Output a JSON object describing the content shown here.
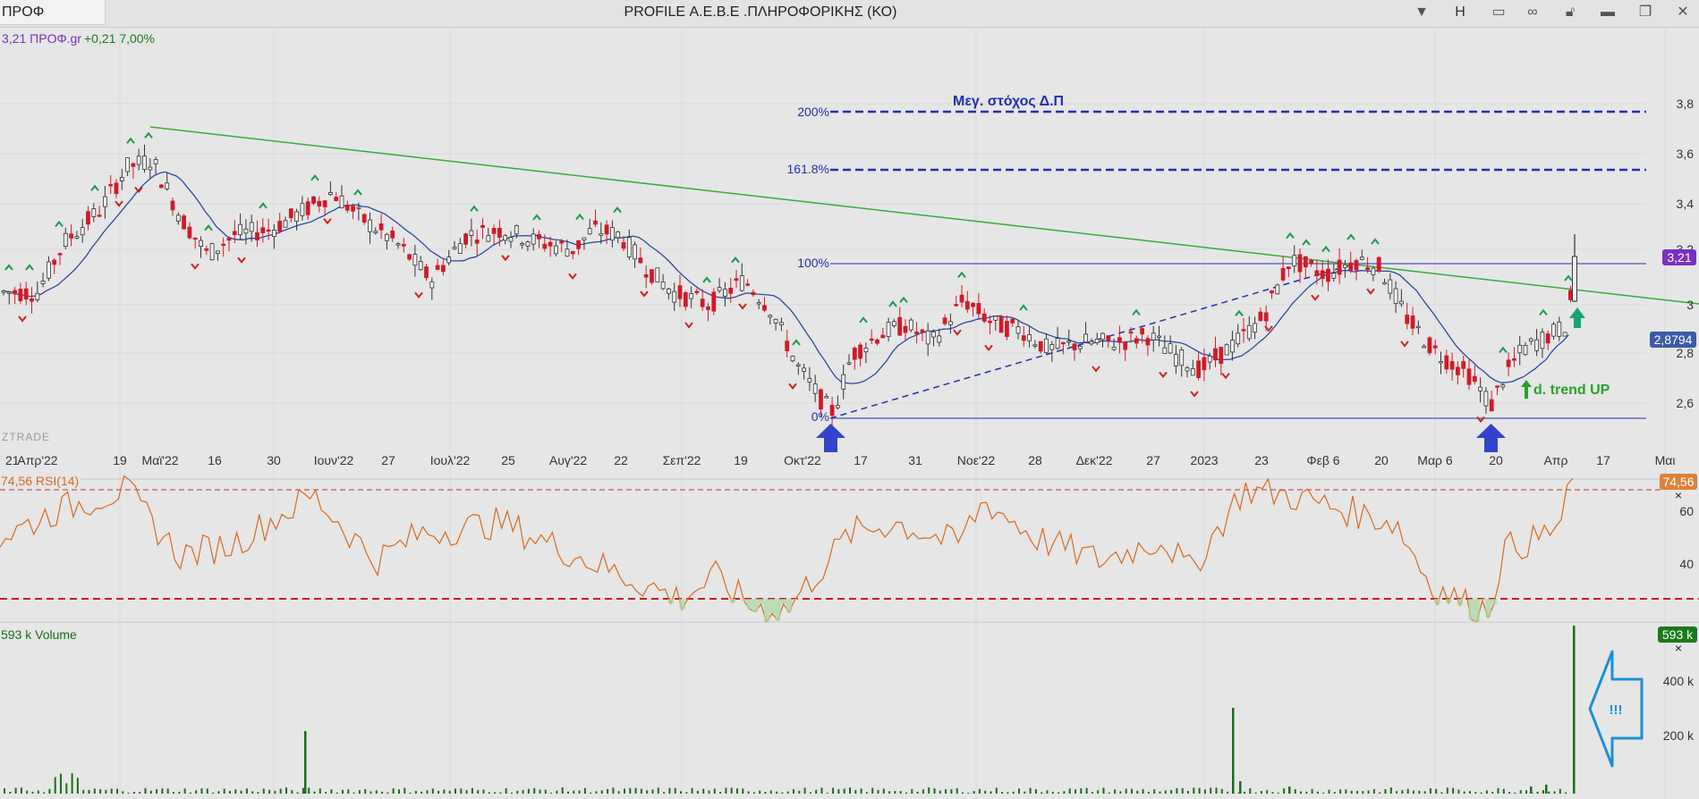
{
  "window": {
    "symbol_tab": "ΠΡΟΦ",
    "title": "PROFILE Α.Ε.Β.Ε .ΠΛΗΡΟΦΟΡΙΚΗΣ (ΚΟ)",
    "h_label": "H"
  },
  "quote": {
    "price_symbol": "3,21 ΠΡΟΦ.gr",
    "change": "+0,21 7,00%"
  },
  "watermark": "ZTRADE",
  "price_panel": {
    "y_ticks": [
      "3,8",
      "3,6",
      "3,4",
      "3,2",
      "3",
      "2,8",
      "2,6"
    ],
    "last_price_badge": "3,21",
    "ma_badge": "2,8794",
    "fib_levels": [
      {
        "label": "200%",
        "value": 3.77
      },
      {
        "label": "161.8%",
        "value": 3.55
      },
      {
        "label": "100%",
        "value": 3.195
      },
      {
        "label": "0%",
        "value": 2.555
      }
    ],
    "target_label": "Μεγ. στόχος Δ.Π",
    "trend_label": "d. trend UP"
  },
  "x_axis_labels": [
    "21",
    "Απρ'22",
    "19",
    "Μαϊ'22",
    "16",
    "30",
    "Ιουν'22",
    "27",
    "Ιουλ'22",
    "25",
    "Αυγ'22",
    "22",
    "Σεπ'22",
    "19",
    "Οκτ'22",
    "17",
    "31",
    "Νοε'22",
    "28",
    "Δεκ'22",
    "27",
    "2023",
    "23",
    "Φεβ 6",
    "20",
    "Μαρ 6",
    "20",
    "Απρ",
    "17",
    "Μαι"
  ],
  "rsi_panel": {
    "label": "74,56 RSI(14)",
    "badge": "74,56",
    "y_ticks": [
      "60",
      "40"
    ],
    "overbought": 70,
    "oversold": 30
  },
  "volume_panel": {
    "label": "593 k Volume",
    "badge": "593 k",
    "y_ticks": [
      "400 k",
      "200 k"
    ],
    "callout": "!!!"
  },
  "colors": {
    "up": "#333333",
    "down": "#d01a2a",
    "ma": "#2b4a9e",
    "fib": "#2030b0",
    "trendline": "#3aaa3a",
    "rsi": "#d66a20",
    "volume": "#1a6e1a",
    "callout": "#1a8fd6"
  }
}
